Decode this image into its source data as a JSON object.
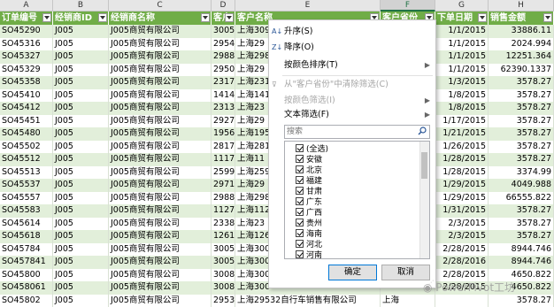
{
  "col_letters": [
    "A",
    "B",
    "C",
    "D",
    "E",
    "F",
    "G",
    "H"
  ],
  "headers": [
    "订单编号",
    "经销商ID",
    "经销商名称",
    "客户ID",
    "客户名称",
    "客户省份",
    "下单日期",
    "销售金额"
  ],
  "rows": [
    [
      "SO45290",
      "J005",
      "J005商贸有限公司",
      "30056",
      "上海309",
      "",
      "1/1/2015",
      "33886.11"
    ],
    [
      "SO45316",
      "J005",
      "J005商贸有限公司",
      "29541",
      "上海29",
      "",
      "1/1/2015",
      "2024.994"
    ],
    [
      "SO45327",
      "J005",
      "J005商贸有限公司",
      "29880",
      "上海298",
      "",
      "1/1/2015",
      "12251.364"
    ],
    [
      "SO45329",
      "J005",
      "J005商贸有限公司",
      "29507",
      "上海29",
      "",
      "1/1/2015",
      "62390.1337"
    ],
    [
      "SO45358",
      "J005",
      "J005商贸有限公司",
      "23172",
      "上海231",
      "",
      "1/3/2015",
      "3578.27"
    ],
    [
      "SO45410",
      "J005",
      "J005商贸有限公司",
      "14149",
      "上海141",
      "",
      "1/8/2015",
      "3578.27"
    ],
    [
      "SO45412",
      "J005",
      "J005商贸有限公司",
      "23137",
      "上海23",
      "",
      "1/8/2015",
      "3578.27"
    ],
    [
      "SO45451",
      "J005",
      "J005商贸有限公司",
      "29279",
      "上海29",
      "",
      "1/17/2015",
      "3578.27"
    ],
    [
      "SO45480",
      "J005",
      "J005商贸有限公司",
      "19564",
      "上海195",
      "",
      "1/21/2015",
      "3578.27"
    ],
    [
      "SO45502",
      "J005",
      "J005商贸有限公司",
      "28173",
      "上海281",
      "",
      "1/26/2015",
      "3578.27"
    ],
    [
      "SO45512",
      "J005",
      "J005商贸有限公司",
      "11175",
      "上海11",
      "",
      "1/28/2015",
      "3578.27"
    ],
    [
      "SO45513",
      "J005",
      "J005商贸有限公司",
      "25996",
      "上海259",
      "",
      "1/28/2015",
      "3374.99"
    ],
    [
      "SO45537",
      "J005",
      "J005商贸有限公司",
      "29711",
      "上海29",
      "",
      "1/29/2015",
      "4049.988"
    ],
    [
      "SO45557",
      "J005",
      "J005商贸有限公司",
      "29883",
      "上海298",
      "",
      "1/29/2015",
      "66555.822"
    ],
    [
      "SO45583",
      "J005",
      "J005商贸有限公司",
      "11274",
      "上海112",
      "",
      "1/31/2015",
      "3578.27"
    ],
    [
      "SO45614",
      "J005",
      "J005商贸有限公司",
      "23385",
      "上海23",
      "",
      "2/3/2015",
      "3578.27"
    ],
    [
      "SO45618",
      "J005",
      "J005商贸有限公司",
      "12618",
      "上海126",
      "",
      "2/3/2015",
      "3578.27"
    ],
    [
      "SO45784",
      "J005",
      "J005商贸有限公司",
      "30052",
      "上海300",
      "",
      "2/28/2015",
      "8944.746"
    ],
    [
      "SO457841",
      "J005",
      "J005商贸有限公司",
      "30052",
      "上海300",
      "",
      "2/28/2016",
      "8944.746"
    ],
    [
      "SO45800",
      "J005",
      "J005商贸有限公司",
      "30084",
      "上海300",
      "",
      "2/28/2015",
      "4650.822"
    ],
    [
      "SO458061",
      "J005",
      "J005商贸有限公司",
      "30084",
      "上海300",
      "",
      "2/28/2015",
      "4650.822"
    ],
    [
      "SO45802",
      "J005",
      "J005商贸有限公司",
      "29532",
      "上海29532自行车销售有限公司",
      "上海",
      "",
      "3578.27"
    ]
  ],
  "menu": {
    "sort_asc": "升序(S)",
    "sort_desc": "降序(O)",
    "sort_color": "按颜色排序(T)",
    "clear_filter": "从\"客户省份\"中清除筛选(C)",
    "filter_color": "按颜色筛选(I)",
    "text_filter": "文本筛选(F)",
    "search_placeholder": "搜索",
    "items": [
      "(全选)",
      "安徽",
      "北京",
      "福建",
      "甘肃",
      "广东",
      "广西",
      "贵州",
      "海南",
      "河北",
      "河南"
    ],
    "ok": "确定",
    "cancel": "取消"
  },
  "watermark": "PowerPivot工坊",
  "colors": {
    "header_green": "#70ad47",
    "band_green": "#e2efda",
    "accent": "#217346"
  }
}
